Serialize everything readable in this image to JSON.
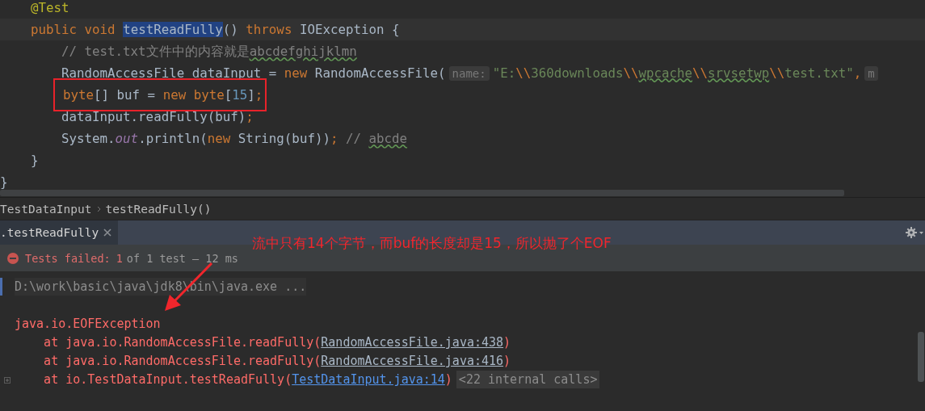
{
  "editor": {
    "lines": [
      {
        "children": [
          {
            "current": false,
            "boxed": false,
            "tokens": [
              {
                "kind": "annotation",
                "text": "@Test"
              }
            ]
          },
          {
            "current": true,
            "boxed": false,
            "tokens": [
              {
                "kind": "keyword",
                "text": "public void "
              },
              {
                "kind": "selected",
                "text": "testReadFully"
              },
              {
                "kind": "plain",
                "text": "() "
              },
              {
                "kind": "keyword",
                "text": "throws"
              },
              {
                "kind": "plain",
                "text": " IOException {"
              }
            ],
            "children": [
              {
                "current": false,
                "boxed": false,
                "tokens": [
                  {
                    "kind": "comment",
                    "text": "// test.txt文件中的内容就是"
                  },
                  {
                    "kind": "comment_typo",
                    "text": "abcdefghijklmn"
                  }
                ]
              },
              {
                "current": false,
                "boxed": false,
                "tokens": [
                  {
                    "kind": "plain",
                    "text": "RandomAccessFile dataInput = "
                  },
                  {
                    "kind": "keyword",
                    "text": "new"
                  },
                  {
                    "kind": "plain",
                    "text": " RandomAccessFile("
                  },
                  {
                    "kind": "hint",
                    "text": "name:"
                  },
                  {
                    "kind": "string",
                    "text": "\"E:"
                  },
                  {
                    "kind": "escape",
                    "text": "\\\\"
                  },
                  {
                    "kind": "string",
                    "text": "360downloads"
                  },
                  {
                    "kind": "escape",
                    "text": "\\\\"
                  },
                  {
                    "kind": "string_typo",
                    "text": "wpcache"
                  },
                  {
                    "kind": "escape",
                    "text": "\\\\"
                  },
                  {
                    "kind": "string_typo",
                    "text": "srvsetwp"
                  },
                  {
                    "kind": "escape",
                    "text": "\\\\"
                  },
                  {
                    "kind": "string",
                    "text": "test.txt\""
                  },
                  {
                    "kind": "keyword",
                    "text": ","
                  },
                  {
                    "kind": "hint",
                    "text": "m"
                  }
                ]
              },
              {
                "current": false,
                "boxed": true,
                "tokens": [
                  {
                    "kind": "keyword",
                    "text": "byte"
                  },
                  {
                    "kind": "plain",
                    "text": "[] buf = "
                  },
                  {
                    "kind": "keyword",
                    "text": "new byte"
                  },
                  {
                    "kind": "plain",
                    "text": "["
                  },
                  {
                    "kind": "number",
                    "text": "15"
                  },
                  {
                    "kind": "plain",
                    "text": "]"
                  },
                  {
                    "kind": "keyword",
                    "text": ";"
                  }
                ]
              },
              {
                "current": false,
                "boxed": false,
                "tokens": [
                  {
                    "kind": "plain",
                    "text": "dataInput.readFully(buf)"
                  },
                  {
                    "kind": "keyword",
                    "text": ";"
                  }
                ]
              },
              {
                "current": false,
                "boxed": false,
                "tokens": [
                  {
                    "kind": "plain",
                    "text": "System."
                  },
                  {
                    "kind": "field",
                    "text": "out"
                  },
                  {
                    "kind": "plain",
                    "text": ".println("
                  },
                  {
                    "kind": "keyword",
                    "text": "new"
                  },
                  {
                    "kind": "plain",
                    "text": " String(buf))"
                  },
                  {
                    "kind": "keyword",
                    "text": ";"
                  },
                  {
                    "kind": "comment",
                    "text": " // "
                  },
                  {
                    "kind": "comment_typo",
                    "text": "abcde"
                  }
                ]
              }
            ]
          },
          {
            "current": false,
            "boxed": false,
            "tokens": [
              {
                "kind": "plain",
                "text": "}"
              }
            ]
          }
        ]
      },
      {
        "current": false,
        "boxed": false,
        "tokens": [
          {
            "kind": "plain",
            "text": "}"
          }
        ]
      }
    ]
  },
  "breadcrumb": [
    "TestDataInput",
    "testReadFully()"
  ],
  "run_panel": {
    "tabs": [
      {
        "label": ".testReadFully",
        "selected": true
      }
    ],
    "status": {
      "failed_label": "Tests failed:",
      "failed_count": "1",
      "detail": "of 1 test – 12 ms"
    },
    "console": [
      {
        "kind": "command",
        "foldable": false,
        "tokens": [
          {
            "kind": "command",
            "text": "D:\\work\\basic\\java\\jdk8\\bin\\java.exe ..."
          }
        ]
      },
      {
        "kind": "blank"
      },
      {
        "kind": "text",
        "foldable": false,
        "tokens": [
          {
            "kind": "error",
            "text": "java.io.EOFException"
          }
        ]
      },
      {
        "kind": "text",
        "foldable": false,
        "tokens": [
          {
            "kind": "error",
            "text": "    at java.io.RandomAccessFile.readFully("
          },
          {
            "kind": "library_link",
            "text": "RandomAccessFile.java:438"
          },
          {
            "kind": "error",
            "text": ")"
          }
        ]
      },
      {
        "kind": "text",
        "foldable": false,
        "tokens": [
          {
            "kind": "error",
            "text": "    at java.io.RandomAccessFile.readFully("
          },
          {
            "kind": "library_link",
            "text": "RandomAccessFile.java:416"
          },
          {
            "kind": "error",
            "text": ")"
          }
        ]
      },
      {
        "kind": "text",
        "foldable": true,
        "tokens": [
          {
            "kind": "error",
            "text": "    at io.TestDataInput.testReadFully("
          },
          {
            "kind": "source_link",
            "text": "TestDataInput.java:14"
          },
          {
            "kind": "error",
            "text": ")"
          },
          {
            "kind": "folded",
            "text": "<22 internal calls>"
          }
        ]
      }
    ]
  },
  "annotation": {
    "note": "流中只有14个字节，而buf的长度却是15，所以抛了个EOF"
  }
}
